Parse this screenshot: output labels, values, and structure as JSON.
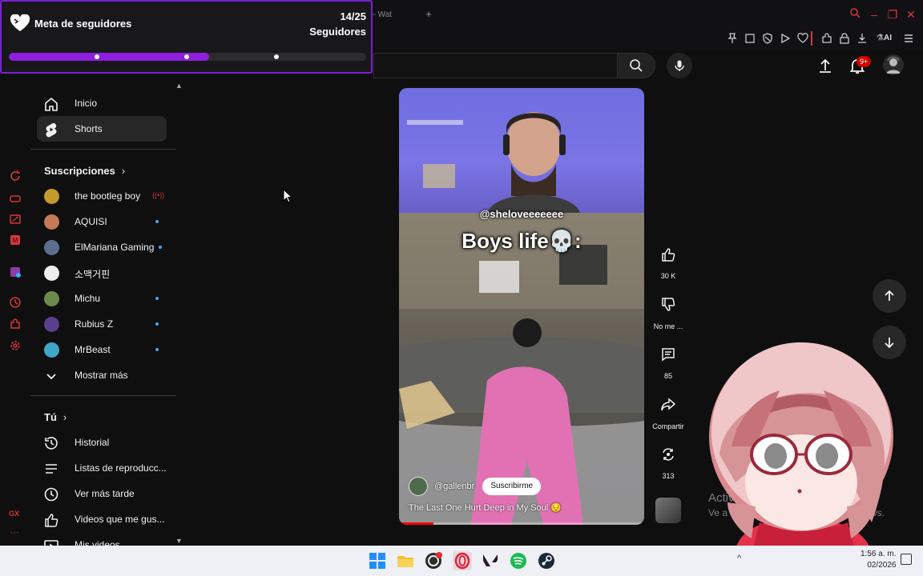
{
  "browser": {
    "tab_title": "ream - Wat",
    "new_tab": "+",
    "ai_label": "AI",
    "window_controls": {
      "minimize": "–",
      "maximize": "❐",
      "close": "✕"
    }
  },
  "goal_widget": {
    "title": "Meta de seguidores",
    "count": "14/25",
    "unit": "Seguidores",
    "progress_fraction": 0.56,
    "accent": "#8e1ee0"
  },
  "sidebar": {
    "main": [
      {
        "label": "Inicio",
        "icon": "home-icon",
        "active": false
      },
      {
        "label": "Shorts",
        "icon": "shorts-icon",
        "active": true
      }
    ],
    "subscriptions_heading": "Suscripciones",
    "subscriptions": [
      {
        "label": "the bootleg boy",
        "status": "live",
        "avatar_color": "#c49a2c"
      },
      {
        "label": "AQUISI",
        "status": "new",
        "avatar_color": "#c47a56"
      },
      {
        "label": "ElMariana Gaming",
        "status": "new",
        "avatar_color": "#5b6e8f"
      },
      {
        "label": "소맥거핀",
        "status": "none",
        "avatar_color": "#eeeeee"
      },
      {
        "label": "Michu",
        "status": "new",
        "avatar_color": "#6c8a4a"
      },
      {
        "label": "Rubius Z",
        "status": "new",
        "avatar_color": "#5a3f8c"
      },
      {
        "label": "MrBeast",
        "status": "new",
        "avatar_color": "#3ea6c8"
      }
    ],
    "show_more": "Mostrar más",
    "you_heading": "Tú",
    "you_items": [
      {
        "label": "Historial",
        "icon": "history-icon"
      },
      {
        "label": "Listas de reproducc...",
        "icon": "playlists-icon"
      },
      {
        "label": "Ver más tarde",
        "icon": "watch-later-icon"
      },
      {
        "label": "Videos que me gus...",
        "icon": "like-icon"
      },
      {
        "label": "Mis videos",
        "icon": "my-videos-icon"
      }
    ]
  },
  "masthead": {
    "notifications_badge": "9+"
  },
  "short": {
    "overlay_handle": "@sheloveeeeeee",
    "overlay_caption": "Boys life💀:",
    "channel": "@gallenbr",
    "subscribe_label": "Suscribirme",
    "title": "The Last One Hurt Deep in My Soul 😔",
    "progress_fraction": 0.14
  },
  "actions": {
    "likes": "30 K",
    "dislike": "No me ...",
    "comments": "85",
    "share": "Compartir",
    "remix": "313"
  },
  "activate_windows": {
    "line1": "Activar W",
    "line2": "Ve a Configura",
    "line3": "Windows."
  },
  "taskbar": {
    "tray_chevron": "^",
    "time": "1:56 a. m.",
    "date": "02/2026"
  },
  "colors": {
    "background": "#0f0f0f",
    "opera_red": "#d8363a",
    "youtube_red": "#ff0000",
    "goal_border": "#7b1fd6"
  }
}
